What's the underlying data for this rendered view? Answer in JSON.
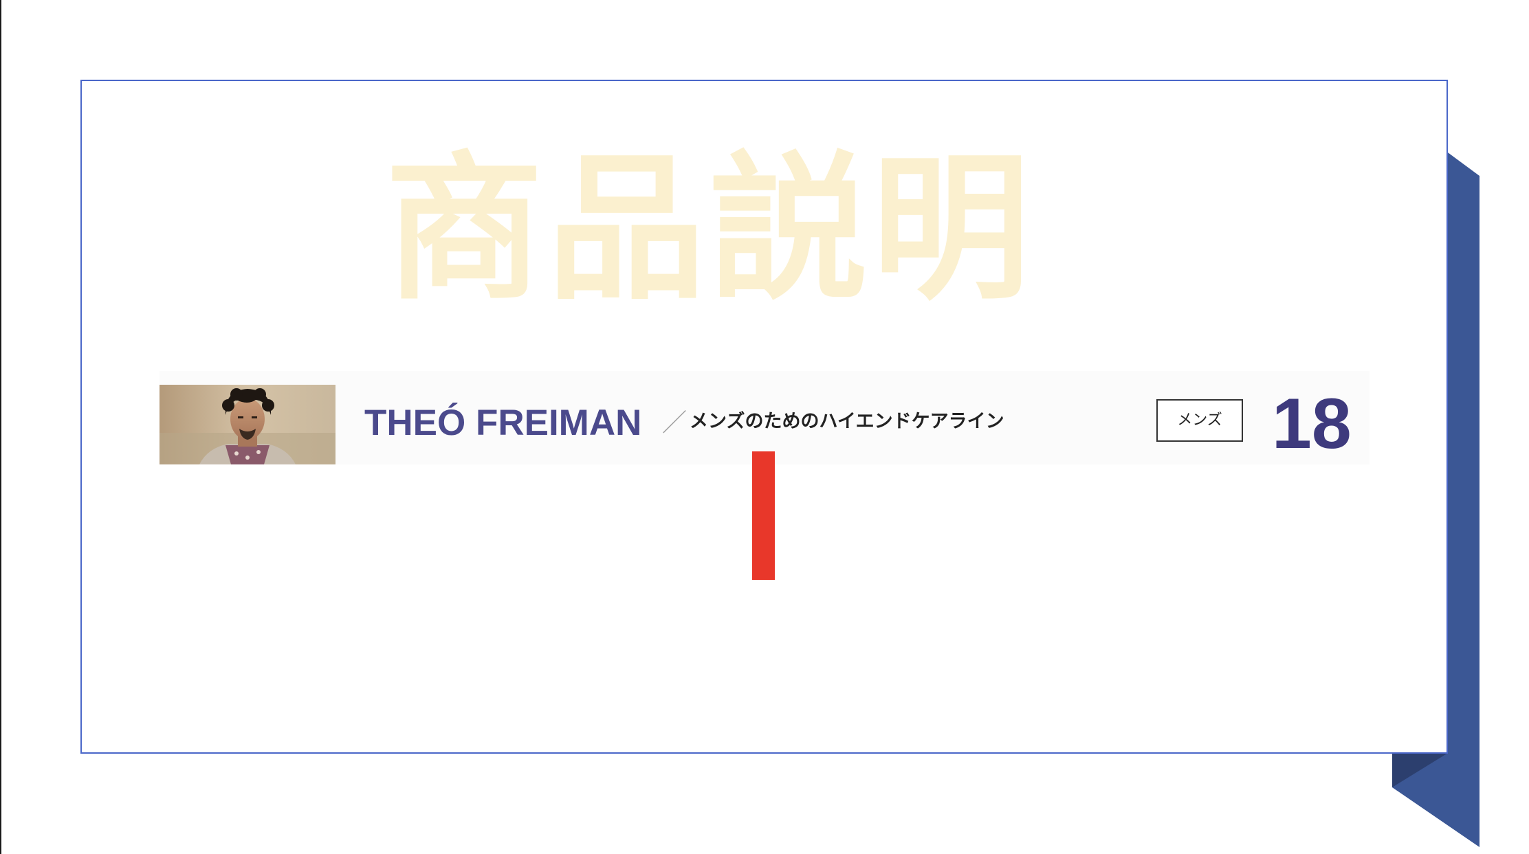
{
  "slide": {
    "watermark_title": "商品説明",
    "brand_name": "THEÓ FREIMAN",
    "separator": "／",
    "tagline": "メンズのためのハイエンドケアライン",
    "category_badge": "メンズ",
    "page_number": "18"
  },
  "colors": {
    "frame_border": "#4a67c9",
    "deco_blue": "#3b5795",
    "deco_blue_dark": "#2c3f6e",
    "watermark": "#fbf0cf",
    "brand_text": "#4b4a8c",
    "page_number": "#3e3a7d",
    "accent_red": "#e8372a"
  },
  "icons": {
    "product_photo": "man-portrait-photo"
  }
}
